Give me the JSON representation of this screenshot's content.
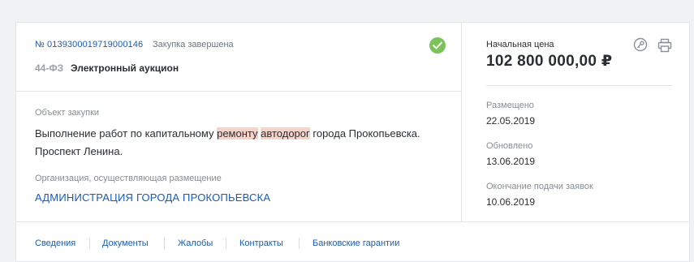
{
  "header": {
    "number": "№ 0139300019719000146",
    "status": "Закупка завершена",
    "law": "44-ФЗ",
    "procedure_type": "Электронный аукцион",
    "status_color": "#7cc25a"
  },
  "object": {
    "label": "Объект закупки",
    "text_before": "Выполнение работ по капитальному ",
    "highlight_1": "ремонту",
    "space": " ",
    "highlight_2": "автодорог",
    "text_after": " города Прокопьевска. Проспект Ленина."
  },
  "organization": {
    "label": "Организация, осуществляющая размещение",
    "name": "АДМИНИСТРАЦИЯ ГОРОДА ПРОКОПЬЕВСКА"
  },
  "price": {
    "label": "Начальная цена",
    "value": "102 800 000,00 ₽"
  },
  "icons": {
    "key": "key-icon",
    "print": "print-icon"
  },
  "dates": [
    {
      "label": "Размещено",
      "value": "22.05.2019"
    },
    {
      "label": "Обновлено",
      "value": "13.06.2019"
    },
    {
      "label": "Окончание подачи заявок",
      "value": "10.06.2019"
    }
  ],
  "tabs": [
    {
      "label": "Сведения"
    },
    {
      "label": "Документы"
    },
    {
      "label": "Жалобы"
    },
    {
      "label": "Контракты"
    },
    {
      "label": "Банковские гарантии"
    }
  ]
}
